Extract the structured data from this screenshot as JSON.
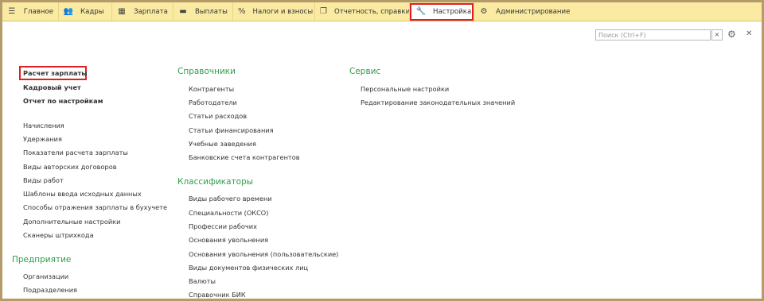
{
  "topbar": {
    "items": [
      {
        "label": "Главное",
        "icon": "menu-icon"
      },
      {
        "label": "Кадры",
        "icon": "people-icon"
      },
      {
        "label": "Зарплата",
        "icon": "calculator-icon"
      },
      {
        "label": "Выплаты",
        "icon": "payment-card-icon"
      },
      {
        "label": "Налоги и взносы",
        "icon": "percent-icon"
      },
      {
        "label": "Отчетность, справки",
        "icon": "documents-icon"
      },
      {
        "label": "Настройка",
        "icon": "wrench-icon",
        "active": true
      },
      {
        "label": "Администрирование",
        "icon": "gear-icon"
      }
    ]
  },
  "search": {
    "placeholder": "Поиск (Ctrl+F)",
    "clear_label": "×"
  },
  "left": {
    "bold_links": [
      "Расчет зарплаты",
      "Кадровый учет",
      "Отчет по настройкам"
    ],
    "links": [
      "Начисления",
      "Удержания",
      "Показатели расчета зарплаты",
      "Виды авторских договоров",
      "Виды работ",
      "Шаблоны ввода исходных данных",
      "Способы отражения зарплаты в бухучете",
      "Дополнительные настройки",
      "Сканеры штрихкода"
    ],
    "enterprise": {
      "title": "Предприятие",
      "links": [
        "Организации",
        "Подразделения"
      ]
    }
  },
  "middle": {
    "directories": {
      "title": "Справочники",
      "links": [
        "Контрагенты",
        "Работодатели",
        "Статьи расходов",
        "Статьи финансирования",
        "Учебные заведения",
        "Банковские счета контрагентов"
      ]
    },
    "classifiers": {
      "title": "Классификаторы",
      "links": [
        "Виды рабочего времени",
        "Специальности (ОКСО)",
        "Профессии рабочих",
        "Основания увольнения",
        "Основания увольнения (пользовательские)",
        "Виды документов физических лиц",
        "Валюты",
        "Справочник БИК"
      ]
    }
  },
  "right": {
    "service": {
      "title": "Сервис",
      "links": [
        "Персональные настройки",
        "Редактирование законодательных значений"
      ]
    }
  },
  "colors": {
    "accent_green": "#2e9e4a",
    "highlight_red": "#e02020",
    "topbar_bg": "#fbeba2"
  }
}
